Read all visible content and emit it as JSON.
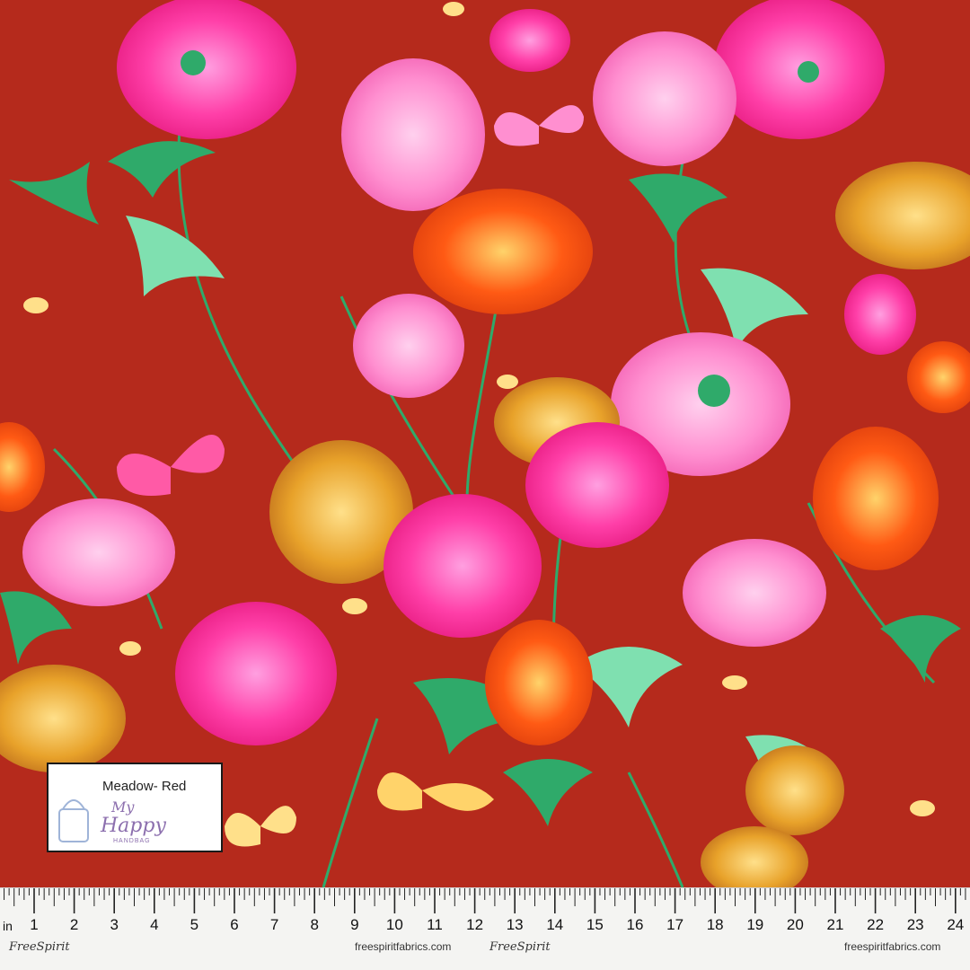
{
  "label": {
    "title": "Meadow- Red",
    "logo_line1": "My",
    "logo_line2": "Happy",
    "logo_line3": "HANDBAG"
  },
  "ruler": {
    "unit": "in",
    "numbers": [
      "1",
      "2",
      "3",
      "4",
      "5",
      "6",
      "7",
      "8",
      "9",
      "10",
      "11",
      "12",
      "13",
      "14",
      "15",
      "16",
      "17",
      "18",
      "19",
      "20",
      "21",
      "22",
      "23",
      "24"
    ],
    "brand_left": "FreeSpirit",
    "url_left": "freespiritfabrics.com",
    "brand_mid": "FreeSpirit",
    "url_right": "freespiritfabrics.com"
  },
  "colors": {
    "background": "#b52a1c",
    "pink": "#ff3fa8",
    "light_pink": "#ff8fd0",
    "orange": "#ff5a14",
    "gold": "#e8a22a",
    "green": "#2faa6a",
    "mint": "#7fe0b0",
    "ruler_bg": "#f4f4f2"
  }
}
